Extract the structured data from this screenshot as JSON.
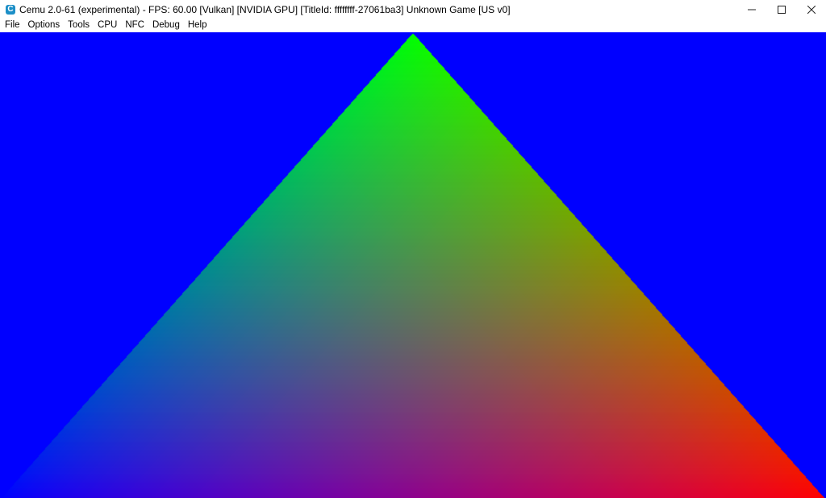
{
  "window": {
    "title": "Cemu 2.0-61 (experimental) - FPS: 60.00 [Vulkan] [NVIDIA GPU] [TitleId: ffffffff-27061ba3] Unknown Game [US v0]",
    "app_icon_glyph": "C",
    "controls": {
      "minimize_icon": "minimize-icon",
      "maximize_icon": "maximize-icon",
      "close_icon": "close-icon"
    }
  },
  "menu": {
    "items": [
      {
        "label": "File"
      },
      {
        "label": "Options"
      },
      {
        "label": "Tools"
      },
      {
        "label": "CPU"
      },
      {
        "label": "NFC"
      },
      {
        "label": "Debug"
      },
      {
        "label": "Help"
      }
    ]
  },
  "render": {
    "clear_color": "#0000ff",
    "triangle": {
      "vertex_colors": {
        "top": "#00ff00",
        "bottom_left": "#0000ff",
        "bottom_right": "#ff0000"
      }
    }
  }
}
